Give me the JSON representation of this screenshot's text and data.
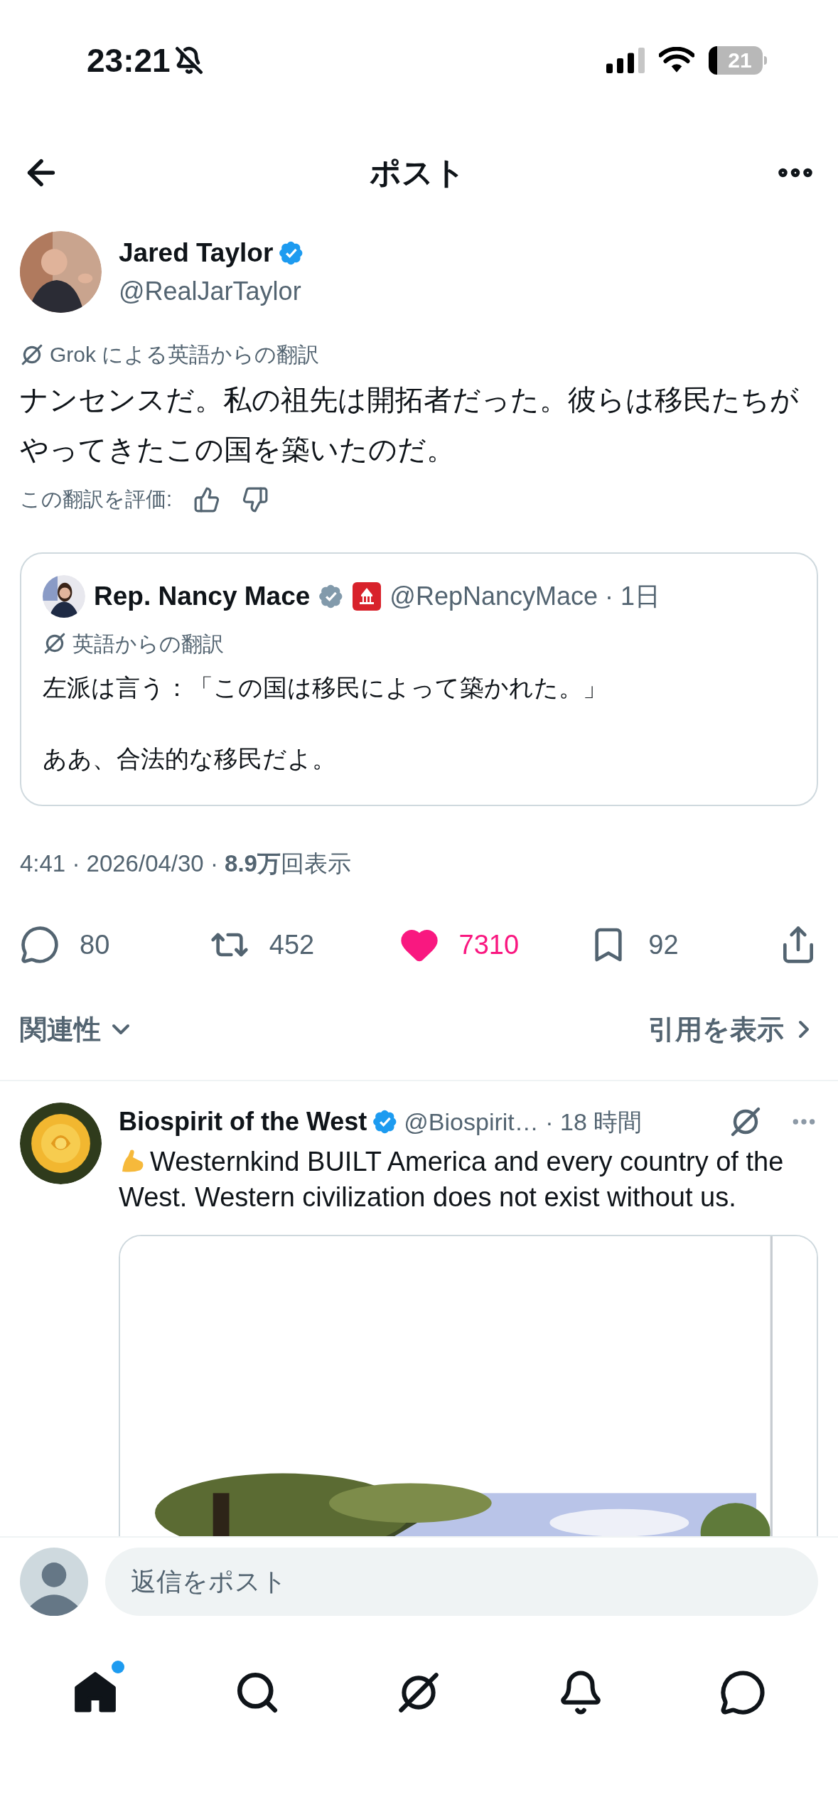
{
  "status_bar": {
    "time": "23:21",
    "battery": "21"
  },
  "header": {
    "title": "ポスト"
  },
  "post": {
    "author": {
      "name": "Jared Taylor",
      "handle": "@RealJarTaylor",
      "badge": {
        "color": "#1d9bf0"
      }
    },
    "translation_label": "Grok による英語からの翻訳",
    "text": "ナンセンスだ。私の祖先は開拓者だった。彼らは移民たちがやってきたこの国を築いたのだ。",
    "rate_label": "この翻訳を評価:",
    "quote": {
      "author": {
        "name": "Rep. Nancy Mace",
        "badge": {
          "color": "#829aab"
        },
        "affiliation": true,
        "handle_time": "@RepNancyMace · 1日"
      },
      "translation_label": "英語からの翻訳",
      "paragraphs": [
        "左派は言う：「この国は移民によって築かれた。」",
        "ああ、合法的な移民だよ。"
      ]
    },
    "meta": "4:41 · 2026/04/30 · **8.9万**回表示",
    "actions": [
      {
        "kind": "reply",
        "count": "80",
        "active": false
      },
      {
        "kind": "repost",
        "count": "452",
        "active": false
      },
      {
        "kind": "like",
        "count": "7310",
        "active": true
      },
      {
        "kind": "bookmark",
        "count": "92",
        "active": false
      },
      {
        "kind": "share",
        "active": false
      }
    ]
  },
  "sort": {
    "label": "関連性",
    "quotes_link": "引用を表示"
  },
  "replies": [
    {
      "author": {
        "name": "Biospirit of the West",
        "badge": {
          "color": "#1d9bf0"
        },
        "handle_time": "@Biospirit… · 18 時間"
      },
      "text": "Westernkind BUILT America and every country of the West. Western civilization does not exist without us."
    }
  ],
  "composer": {
    "placeholder": "返信をポスト"
  },
  "tab_bar": [
    {
      "kind": "home",
      "selected": true,
      "badge": true
    },
    {
      "kind": "search",
      "selected": false,
      "badge": false
    },
    {
      "kind": "grok",
      "selected": false,
      "badge": false
    },
    {
      "kind": "notifications",
      "selected": false,
      "badge": false
    },
    {
      "kind": "messages",
      "selected": false,
      "badge": false
    }
  ]
}
